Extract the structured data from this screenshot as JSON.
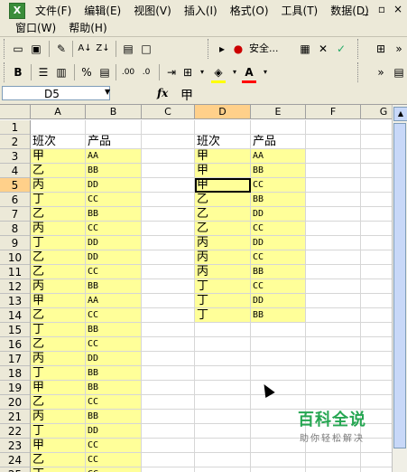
{
  "menu": {
    "row1": [
      "文件(F)",
      "编辑(E)",
      "视图(V)",
      "插入(I)",
      "格式(O)",
      "工具(T)",
      "数据(D)"
    ],
    "row2": [
      "窗口(W)",
      "帮助(H)"
    ],
    "window_controls": [
      "_",
      "▫",
      "×"
    ]
  },
  "toolbar1": {
    "security_label": "安全..."
  },
  "formula_bar": {
    "name_box": "D5",
    "fx": "fx",
    "value": "甲"
  },
  "columns": [
    "A",
    "B",
    "C",
    "D",
    "E",
    "F",
    "G"
  ],
  "rows": [
    "1",
    "2",
    "3",
    "4",
    "5",
    "6",
    "7",
    "8",
    "9",
    "10",
    "11",
    "12",
    "13",
    "14",
    "15",
    "16",
    "17",
    "18",
    "19",
    "20",
    "21",
    "22",
    "23",
    "24",
    "25"
  ],
  "table_left": {
    "header": [
      "班次",
      "产品"
    ],
    "data": [
      [
        "甲",
        "AA"
      ],
      [
        "乙",
        "BB"
      ],
      [
        "丙",
        "DD"
      ],
      [
        "丁",
        "CC"
      ],
      [
        "乙",
        "BB"
      ],
      [
        "丙",
        "CC"
      ],
      [
        "丁",
        "DD"
      ],
      [
        "乙",
        "DD"
      ],
      [
        "乙",
        "CC"
      ],
      [
        "丙",
        "BB"
      ],
      [
        "甲",
        "AA"
      ],
      [
        "乙",
        "CC"
      ],
      [
        "丁",
        "BB"
      ],
      [
        "乙",
        "CC"
      ],
      [
        "丙",
        "DD"
      ],
      [
        "丁",
        "BB"
      ],
      [
        "甲",
        "BB"
      ],
      [
        "乙",
        "CC"
      ],
      [
        "丙",
        "BB"
      ],
      [
        "丁",
        "DD"
      ],
      [
        "甲",
        "CC"
      ],
      [
        "乙",
        "CC"
      ],
      [
        "丁",
        "CC"
      ]
    ]
  },
  "table_right": {
    "header": [
      "班次",
      "产品"
    ],
    "data": [
      [
        "甲",
        "AA"
      ],
      [
        "甲",
        "BB"
      ],
      [
        "甲",
        "CC"
      ],
      [
        "乙",
        "BB"
      ],
      [
        "乙",
        "DD"
      ],
      [
        "乙",
        "CC"
      ],
      [
        "丙",
        "DD"
      ],
      [
        "丙",
        "CC"
      ],
      [
        "丙",
        "BB"
      ],
      [
        "丁",
        "CC"
      ],
      [
        "丁",
        "DD"
      ],
      [
        "丁",
        "BB"
      ]
    ]
  },
  "watermark": {
    "title": "百科全说",
    "subtitle": "助你轻松解决"
  }
}
